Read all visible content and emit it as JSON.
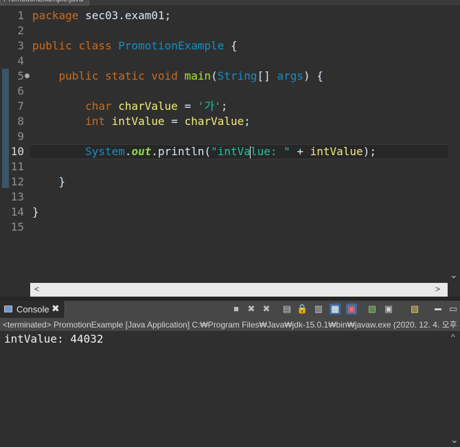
{
  "editor": {
    "tab_title": "PromotionExample.java",
    "lines": [
      {
        "num": "1"
      },
      {
        "num": "2"
      },
      {
        "num": "3"
      },
      {
        "num": "4"
      },
      {
        "num": "5"
      },
      {
        "num": "6"
      },
      {
        "num": "7"
      },
      {
        "num": "8"
      },
      {
        "num": "9"
      },
      {
        "num": "10"
      },
      {
        "num": "11"
      },
      {
        "num": "12"
      },
      {
        "num": "13"
      },
      {
        "num": "14"
      },
      {
        "num": "15"
      }
    ],
    "code": {
      "l1": {
        "kw": "package",
        "rest": " sec03.exam01;"
      },
      "l3": {
        "kw1": "public",
        "kw2": "class",
        "name": "PromotionExample",
        "rest": " {"
      },
      "l5": {
        "kw1": "public",
        "kw2": "static",
        "kw3": "void",
        "method": "main",
        "p1": "(",
        "type": "String",
        "p2": "[] ",
        "param": "args",
        "p3": ") {"
      },
      "l7": {
        "type": "char",
        "var": "charValue",
        "eq": " = ",
        "str": "'가'",
        "end": ";"
      },
      "l8": {
        "type": "int",
        "var": "intValue",
        "eq": " = ",
        "ref": "charValue",
        "end": ";"
      },
      "l10": {
        "cls": "System",
        "dot1": ".",
        "field": "out",
        "dot2": ".",
        "method": "println",
        "p1": "(",
        "str_a": "\"intVa",
        "str_b": "lue: \"",
        "plus": " + ",
        "ref": "intValue",
        "end": ");"
      },
      "l12": {
        "brace": "}"
      },
      "l14": {
        "brace": "}"
      }
    },
    "current_line": "10",
    "hscroll": {
      "left_arrow": "<",
      "right_arrow": ">"
    },
    "vscroll": {
      "down_arrow": "⌄"
    }
  },
  "console": {
    "tab_label": "Console",
    "tab_close": "✖",
    "status": "<terminated> PromotionExample [Java Application] C:₩Program Files₩Java₩jdk-15.0.1₩bin₩javaw.exe  (2020. 12. 4. 오후",
    "output": "intValue: 44032",
    "toolbar": {
      "terminate": "■",
      "remove": "✖",
      "remove_all": "✖",
      "clear": "▤",
      "scroll_lock": "🔒",
      "word_wrap": "▥",
      "pin": "▦",
      "display_selected": "▣",
      "open_console": "▧",
      "minimize": "▬",
      "maximize": "▭"
    },
    "scroll_up": "^",
    "scroll_down": "⌄"
  },
  "colors": {
    "background": "#2f2f2f",
    "keyword": "#cc6c1d",
    "type": "#1290c3",
    "method": "#a7ec21",
    "variable": "#f3ec79",
    "string": "#17c6a3"
  }
}
